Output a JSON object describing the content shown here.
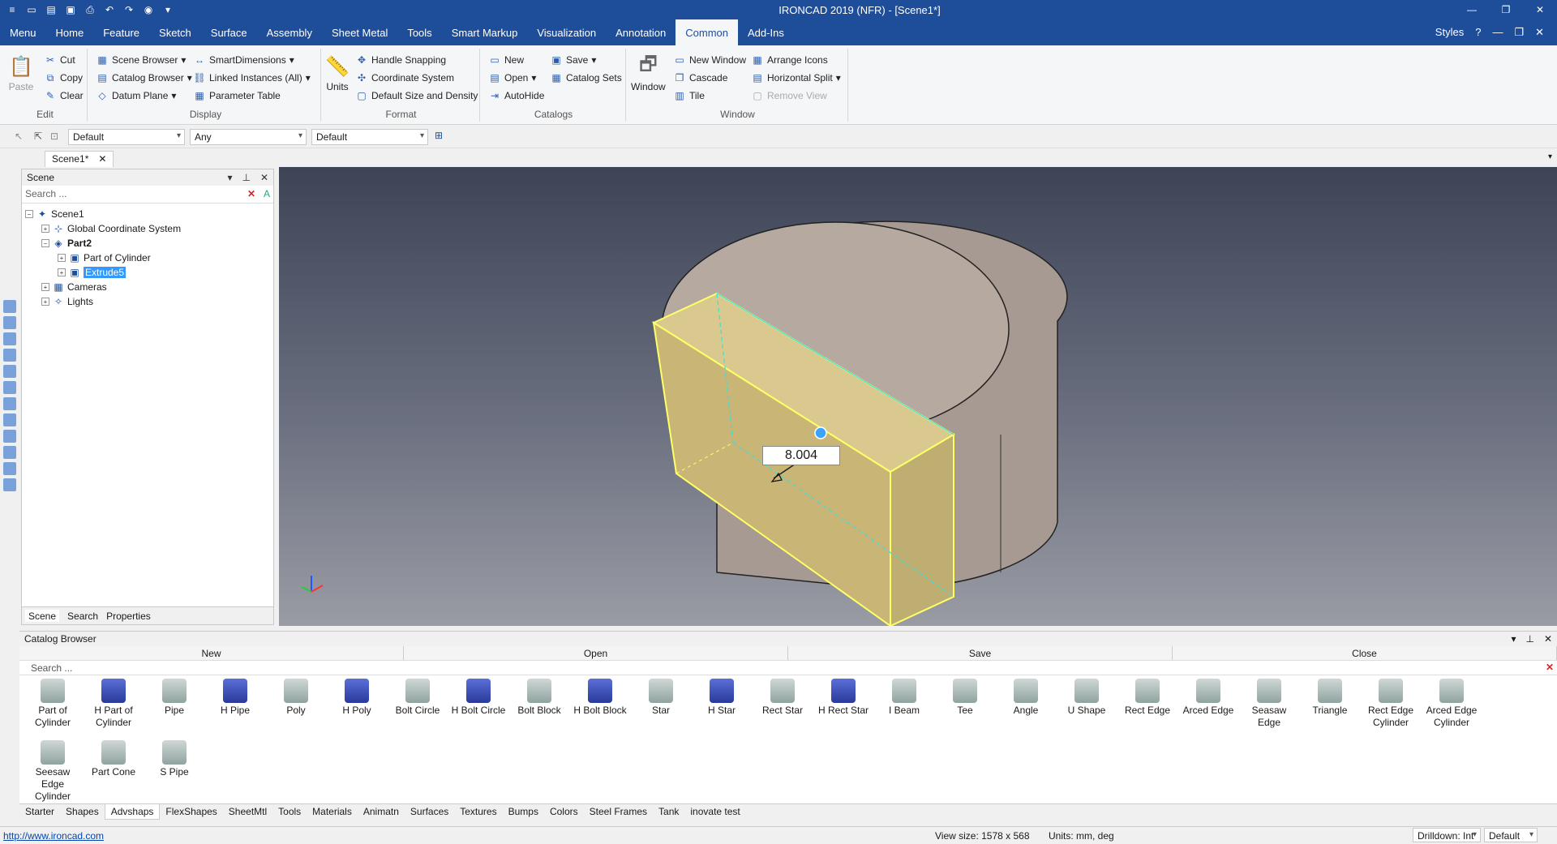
{
  "app": {
    "title": "IRONCAD 2019 (NFR) - [Scene1*]"
  },
  "ribbon_tabs": [
    "Menu",
    "Home",
    "Feature",
    "Sketch",
    "Surface",
    "Assembly",
    "Sheet Metal",
    "Tools",
    "Smart Markup",
    "Visualization",
    "Annotation",
    "Common",
    "Add-Ins"
  ],
  "active_tab": "Common",
  "styles_label": "Styles",
  "groups": {
    "edit": {
      "name": "Edit",
      "paste": "Paste",
      "cut": "Cut",
      "copy": "Copy",
      "clear": "Clear"
    },
    "display": {
      "name": "Display",
      "scene_browser": "Scene Browser",
      "catalog_browser": "Catalog Browser",
      "datum_plane": "Datum Plane",
      "smart_dimensions": "SmartDimensions",
      "linked_instances": "Linked Instances (All)",
      "parameter_table": "Parameter Table"
    },
    "format": {
      "name": "Format",
      "units": "Units",
      "handle_snapping": "Handle Snapping",
      "coordinate_system": "Coordinate System",
      "default_size": "Default Size and Density"
    },
    "catalogs": {
      "name": "Catalogs",
      "new": "New",
      "open": "Open",
      "autohide": "AutoHide",
      "save": "Save",
      "catalog_sets": "Catalog Sets"
    },
    "window": {
      "name": "Window",
      "window": "Window",
      "new_window": "New Window",
      "cascade": "Cascade",
      "tile": "Tile",
      "arrange_icons": "Arrange Icons",
      "horizontal_split": "Horizontal Split",
      "remove_view": "Remove View"
    }
  },
  "toolbar2": {
    "combo1": "Default",
    "combo2": "Any",
    "combo3": "Default"
  },
  "doc_tab": "Scene1*",
  "scene_panel": {
    "title": "Scene",
    "search_placeholder": "Search ...",
    "nodes": [
      {
        "label": "Scene1",
        "level": 0,
        "exp": "−",
        "icon": "scene-icon",
        "bold": false,
        "selected": false
      },
      {
        "label": "Global Coordinate System",
        "level": 1,
        "exp": "+",
        "icon": "axes-icon",
        "bold": false,
        "selected": false
      },
      {
        "label": "Part2",
        "level": 1,
        "exp": "−",
        "icon": "part-icon",
        "bold": true,
        "selected": false
      },
      {
        "label": "Part of Cylinder",
        "level": 2,
        "exp": "+",
        "icon": "feature-icon",
        "bold": false,
        "selected": false
      },
      {
        "label": "Extrude5",
        "level": 2,
        "exp": "+",
        "icon": "feature-icon",
        "bold": false,
        "selected": true
      },
      {
        "label": "Cameras",
        "level": 1,
        "exp": "+",
        "icon": "camera-icon",
        "bold": false,
        "selected": false
      },
      {
        "label": "Lights",
        "level": 1,
        "exp": "+",
        "icon": "light-icon",
        "bold": false,
        "selected": false
      }
    ],
    "tabs": [
      "Scene",
      "Search",
      "Properties"
    ]
  },
  "viewport": {
    "dimension_value": "8.004"
  },
  "catalog": {
    "title": "Catalog Browser",
    "actions": [
      "New",
      "Open",
      "Save",
      "Close"
    ],
    "search_placeholder": "Search ...",
    "items": [
      {
        "label": "Part of Cylinder",
        "blue": false
      },
      {
        "label": "H Part of Cylinder",
        "blue": true
      },
      {
        "label": "Pipe",
        "blue": false
      },
      {
        "label": "H Pipe",
        "blue": true
      },
      {
        "label": "Poly",
        "blue": false
      },
      {
        "label": "H Poly",
        "blue": true
      },
      {
        "label": "Bolt Circle",
        "blue": false
      },
      {
        "label": "H Bolt Circle",
        "blue": true
      },
      {
        "label": "Bolt Block",
        "blue": false
      },
      {
        "label": "H Bolt Block",
        "blue": true
      },
      {
        "label": "Star",
        "blue": false
      },
      {
        "label": "H Star",
        "blue": true
      },
      {
        "label": "Rect Star",
        "blue": false
      },
      {
        "label": "H Rect Star",
        "blue": true
      },
      {
        "label": "I Beam",
        "blue": false
      },
      {
        "label": "Tee",
        "blue": false
      },
      {
        "label": "Angle",
        "blue": false
      },
      {
        "label": "U Shape",
        "blue": false
      },
      {
        "label": "Rect Edge",
        "blue": false
      },
      {
        "label": "Arced Edge",
        "blue": false
      },
      {
        "label": "Seasaw Edge",
        "blue": false
      },
      {
        "label": "Triangle",
        "blue": false
      },
      {
        "label": "Rect Edge Cylinder",
        "blue": false
      },
      {
        "label": "Arced Edge Cylinder",
        "blue": false
      },
      {
        "label": "Seesaw Edge Cylinder",
        "blue": false
      },
      {
        "label": "Part Cone",
        "blue": false
      },
      {
        "label": "S Pipe",
        "blue": false
      }
    ],
    "tabs": [
      "Starter",
      "Shapes",
      "Advshaps",
      "FlexShapes",
      "SheetMtl",
      "Tools",
      "Materials",
      "Animatn",
      "Surfaces",
      "Textures",
      "Bumps",
      "Colors",
      "Steel Frames",
      "Tank",
      "inovate test"
    ],
    "active_tab": "Advshaps"
  },
  "status": {
    "link": "http://www.ironcad.com",
    "view_size": "View size: 1578 x  568",
    "units": "Units: mm, deg",
    "drilldown": "Drilldown: Int",
    "default": "Default"
  }
}
